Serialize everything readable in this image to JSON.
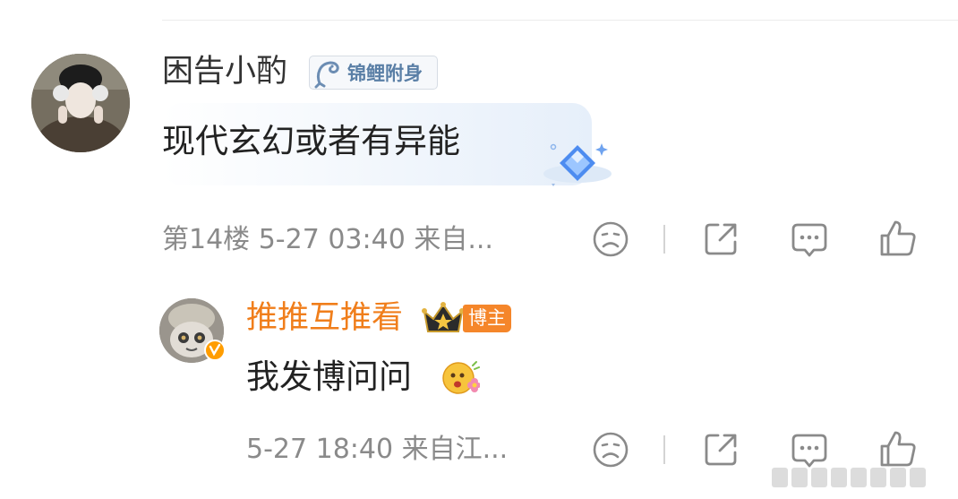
{
  "comment": {
    "username": "困告小酌",
    "badge": "锦鲤附身",
    "content": "现代玄幻或者有异能",
    "meta": "第14楼  5-27 03:40  来自..."
  },
  "reply": {
    "username": "推推互推看",
    "host_tag": "博主",
    "content": "我发博问问",
    "meta": "5-27 18:40  来自江..."
  },
  "icons": [
    "sad-face-icon",
    "share-icon",
    "comment-icon",
    "like-icon",
    "crown-icon",
    "koi-fish-icon",
    "diamond-icon",
    "flower-emoji-icon",
    "verified-icon"
  ],
  "colors": {
    "reply_username": "#f07e1b",
    "host_tag_bg": "#f5862a",
    "badge_text": "#5a7fa6",
    "meta_text": "#8a8a8a"
  }
}
